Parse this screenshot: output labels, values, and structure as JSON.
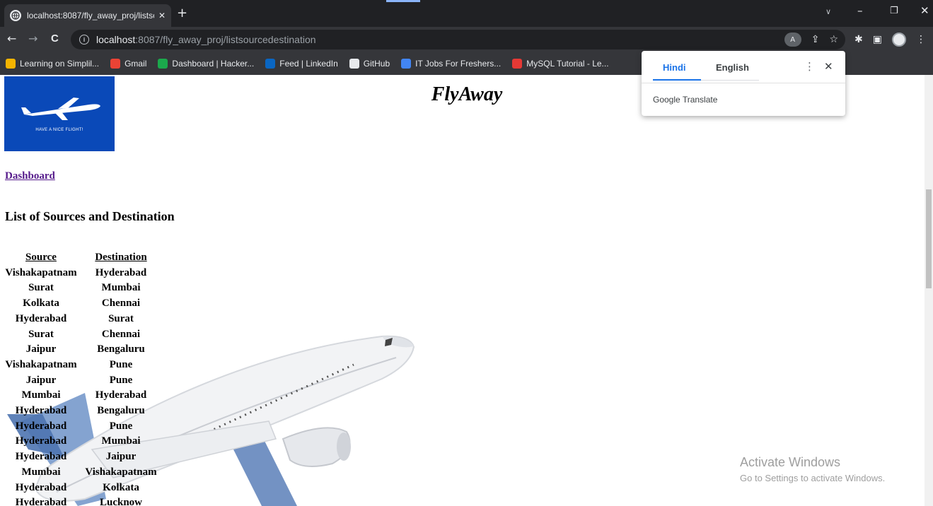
{
  "browser": {
    "tab_title": "localhost:8087/fly_away_proj/listsc",
    "tab_close": "✕",
    "new_tab": "+",
    "tab_search": "∨",
    "window_minimize": "–",
    "window_restore": "❐",
    "window_close": "✕",
    "back": "←",
    "forward": "→",
    "reload": "C",
    "url_host": "localhost",
    "url_path": ":8087/fly_away_proj/listsourcedestination",
    "share_icon": "⇪",
    "star_icon": "☆",
    "extensions_icon": "✱",
    "sidepanel_icon": "▣",
    "menu_icon": "⋮"
  },
  "bookmarks": [
    {
      "label": "Learning on Simplil...",
      "color": "#f4b400"
    },
    {
      "label": "Gmail",
      "color": "#ea4335"
    },
    {
      "label": "Dashboard | Hacker...",
      "color": "#1ba94c"
    },
    {
      "label": "Feed | LinkedIn",
      "color": "#0a66c2"
    },
    {
      "label": "GitHub",
      "color": "#e8eaed"
    },
    {
      "label": "IT Jobs For Freshers...",
      "color": "#4285f4"
    },
    {
      "label": "MySQL Tutorial - Le...",
      "color": "#e53935"
    }
  ],
  "translate_popup": {
    "tab_hindi": "Hindi",
    "tab_english": "English",
    "more": "⋮",
    "close": "✕",
    "footer": "Google Translate"
  },
  "page": {
    "logo_text": "HAVE A NICE FLIGHT!",
    "brand": "FlyAway",
    "dashboard_link": "Dashboard",
    "heading": "List of Sources and Destination",
    "table": {
      "headers": [
        "Source",
        "Destination"
      ],
      "rows": [
        [
          "Vishakapatnam",
          "Hyderabad"
        ],
        [
          "Surat",
          "Mumbai"
        ],
        [
          "Kolkata",
          "Chennai"
        ],
        [
          "Hyderabad",
          "Surat"
        ],
        [
          "Surat",
          "Chennai"
        ],
        [
          "Jaipur",
          "Bengaluru"
        ],
        [
          "Vishakapatnam",
          "Pune"
        ],
        [
          "Jaipur",
          "Pune"
        ],
        [
          "Mumbai",
          "Hyderabad"
        ],
        [
          "Hyderabad",
          "Bengaluru"
        ],
        [
          "Hyderabad",
          "Pune"
        ],
        [
          "Hyderabad",
          "Mumbai"
        ],
        [
          "Hyderabad",
          "Jaipur"
        ],
        [
          "Mumbai",
          "Vishakapatnam"
        ],
        [
          "Hyderabad",
          "Kolkata"
        ],
        [
          "Hyderabad",
          "Lucknow"
        ]
      ]
    }
  },
  "watermark": {
    "line1": "Activate Windows",
    "line2": "Go to Settings to activate Windows."
  },
  "colors": {
    "chrome_dark": "#202124",
    "chrome_toolbar": "#35363a",
    "logo_blue": "#0a49b8",
    "visited_link": "#551a8b",
    "translate_accent": "#1a73e8"
  }
}
